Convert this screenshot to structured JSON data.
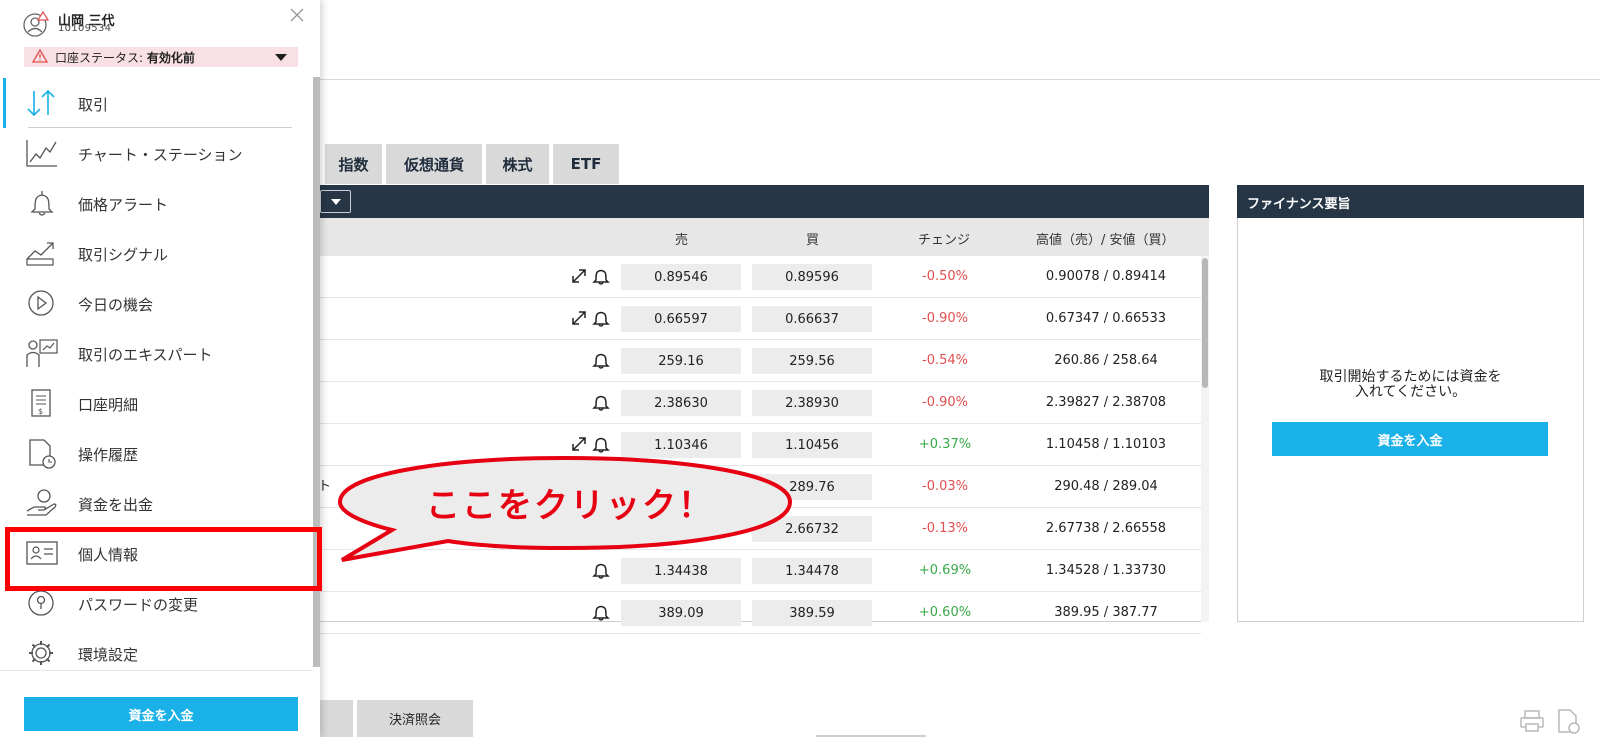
{
  "tabs": [
    "指数",
    "仮想通貨",
    "株式",
    "ETF"
  ],
  "columns": {
    "sell": "売",
    "buy": "買",
    "change": "チェンジ",
    "highlow": "高値（売）/ 安値（買）"
  },
  "rows": [
    {
      "sell": "0.89546",
      "buy": "0.89596",
      "change": "-0.50%",
      "hl": "0.90078 / 0.89414",
      "icons": [
        "expand-icon",
        "bell-icon"
      ]
    },
    {
      "sell": "0.66597",
      "buy": "0.66637",
      "change": "-0.90%",
      "hl": "0.67347 / 0.66533",
      "icons": [
        "expand-icon",
        "bell-icon"
      ]
    },
    {
      "sell": "259.16",
      "buy": "259.56",
      "change": "-0.54%",
      "hl": "260.86 / 258.64",
      "icons": [
        "bell-icon"
      ]
    },
    {
      "sell": "2.38630",
      "buy": "2.38930",
      "change": "-0.90%",
      "hl": "2.39827 / 2.38708",
      "icons": [
        "bell-icon"
      ]
    },
    {
      "sell": "1.10346",
      "buy": "1.10456",
      "change": "+0.37%",
      "hl": "1.10458 / 1.10103",
      "icons": [
        "expand-icon",
        "bell-icon"
      ]
    },
    {
      "sell": "",
      "buy": "289.76",
      "change": "-0.03%",
      "hl": "290.48 / 289.04",
      "icons": []
    },
    {
      "sell": "",
      "buy": "2.66732",
      "change": "-0.13%",
      "hl": "2.67738 / 2.66558",
      "icons": []
    },
    {
      "sell": "1.34438",
      "buy": "1.34478",
      "change": "+0.69%",
      "hl": "1.34528 / 1.33730",
      "icons": [
        "bell-icon"
      ]
    },
    {
      "sell": "389.09",
      "buy": "389.59",
      "change": "+0.60%",
      "hl": "389.95 / 387.77",
      "icons": [
        "bell-icon"
      ]
    }
  ],
  "partial_row_text": "ト",
  "finance": {
    "title": "ファイナンス要旨",
    "message_line1": "取引開始するためには資金を",
    "message_line2": "入れてください。",
    "button": "資金を入金"
  },
  "bottom_tabs": [
    "決済照会"
  ],
  "sidebar": {
    "user_name": "山岡 三代",
    "user_id": "10109534",
    "status_label": "口座ステータス:",
    "status_value": "有効化前",
    "items": [
      {
        "label": "取引",
        "icon": "trade-arrows-icon"
      },
      {
        "label": "チャート・ステーション",
        "icon": "chart-line-icon"
      },
      {
        "label": "価格アラート",
        "icon": "bell-icon"
      },
      {
        "label": "取引シグナル",
        "icon": "signal-icon"
      },
      {
        "label": "今日の機会",
        "icon": "play-circle-icon"
      },
      {
        "label": "取引のエキスパート",
        "icon": "expert-icon"
      },
      {
        "label": "口座明細",
        "icon": "statement-icon"
      },
      {
        "label": "操作履歴",
        "icon": "history-icon"
      },
      {
        "label": "資金を出金",
        "icon": "withdraw-icon"
      },
      {
        "label": "個人情報",
        "icon": "id-card-icon"
      },
      {
        "label": "パスワードの変更",
        "icon": "lock-icon"
      },
      {
        "label": "環境設定",
        "icon": "gear-icon"
      }
    ],
    "deposit_button": "資金を入金"
  },
  "callout": "ここをクリック！",
  "colors": {
    "accent": "#1ab0e8",
    "header": "#263646",
    "negative": "#e05050",
    "positive": "#3aa84a",
    "highlight": "#ff0000"
  }
}
